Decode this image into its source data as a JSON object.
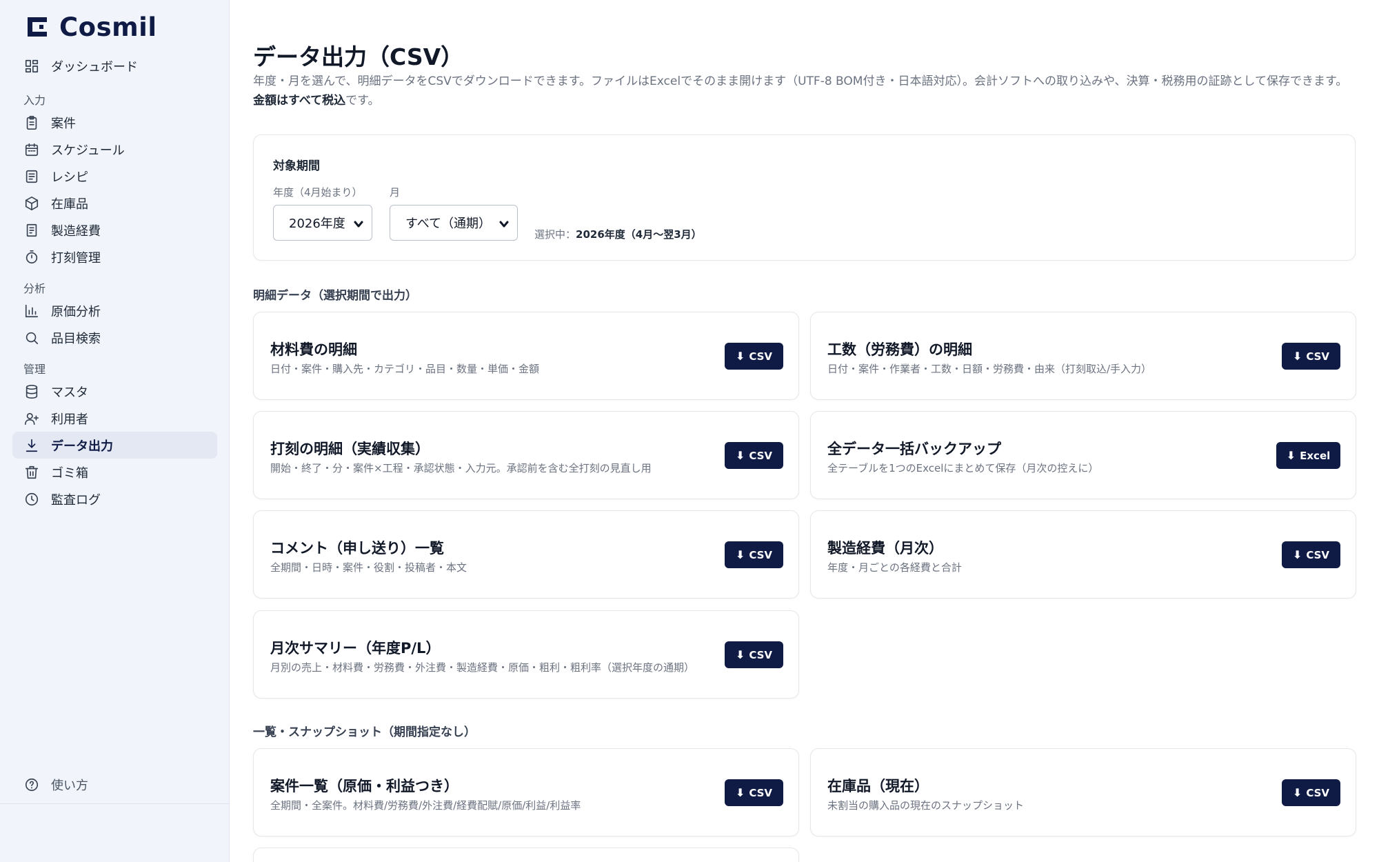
{
  "app": {
    "name": "Cosmil"
  },
  "sidebar": {
    "dashboard": "ダッシュボード",
    "groups": [
      {
        "label": "入力",
        "items": [
          "案件",
          "スケジュール",
          "レシピ",
          "在庫品",
          "製造経費",
          "打刻管理"
        ]
      },
      {
        "label": "分析",
        "items": [
          "原価分析",
          "品目検索"
        ]
      },
      {
        "label": "管理",
        "items": [
          "マスタ",
          "利用者",
          "データ出力",
          "ゴミ箱",
          "監査ログ"
        ]
      }
    ],
    "help": "使い方"
  },
  "page": {
    "title": "データ出力（CSV）",
    "description_main": "年度・月を選んで、明細データをCSVでダウンロードできます。ファイルはExcelでそのまま開けます（UTF-8 BOM付き・日本語対応）。会計ソフトへの取り込みや、決算・税務用の証跡として保存できます。",
    "description_bold": "金額はすべて税込",
    "description_tail": "です。"
  },
  "period": {
    "title": "対象期間",
    "year_label": "年度（4月始まり）",
    "year_value": "2026年度",
    "month_label": "月",
    "month_value": "すべて（通期）",
    "selected_prefix": "選択中：",
    "selected_value": "2026年度（4月〜翌3月）"
  },
  "sections": {
    "detail": "明細データ（選択期間で出力）",
    "snapshot": "一覧・スナップショット（期間指定なし）"
  },
  "exports": [
    {
      "title": "材料費の明細",
      "sub": "日付・案件・購入先・カテゴリ・品目・数量・単価・金額",
      "button": "CSV"
    },
    {
      "title": "工数（労務費）の明細",
      "sub": "日付・案件・作業者・工数・日額・労務費・由来（打刻取込/手入力）",
      "button": "CSV"
    },
    {
      "title": "打刻の明細（実績収集）",
      "sub": "開始・終了・分・案件×工程・承認状態・入力元。承認前を含む全打刻の見直し用",
      "button": "CSV"
    },
    {
      "title": "全データ一括バックアップ",
      "sub": "全テーブルを1つのExcelにまとめて保存（月次の控えに）",
      "button": "Excel"
    },
    {
      "title": "コメント（申し送り）一覧",
      "sub": "全期間・日時・案件・役割・投稿者・本文",
      "button": "CSV"
    },
    {
      "title": "製造経費（月次）",
      "sub": "年度・月ごとの各経費と合計",
      "button": "CSV"
    },
    {
      "title": "月次サマリー（年度P/L）",
      "sub": "月別の売上・材料費・労務費・外注費・製造経費・原価・粗利・粗利率（選択年度の通期）",
      "button": "CSV"
    }
  ],
  "snapshots": [
    {
      "title": "案件一覧（原価・利益つき）",
      "sub": "全期間・全案件。材料費/労務費/外注費/経費配賦/原価/利益/利益率",
      "button": "CSV"
    },
    {
      "title": "在庫品（現在）",
      "sub": "未割当の購入品の現在のスナップショット",
      "button": "CSV"
    }
  ],
  "colors": {
    "brand": "#0f1b45",
    "sidebar_bg": "#f1f4fa",
    "active_bg": "#e3e8f3"
  }
}
